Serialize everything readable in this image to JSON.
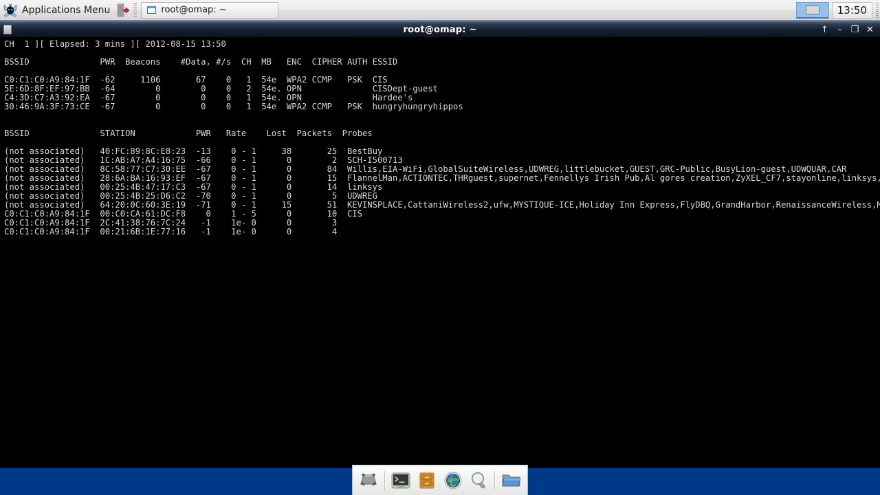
{
  "panel": {
    "applications_menu_label": "Applications Menu",
    "mouse_icon": "xfce-mouse-icon",
    "logout_icon": "logout-door-icon",
    "window_button": {
      "label": "root@omap: ~",
      "icon": "window-icon"
    },
    "pager_icon": "workspace-pager-icon",
    "clock": "13:50"
  },
  "window": {
    "title": "root@omap: ~",
    "buttons": [
      {
        "name": "shade-button",
        "glyph": "↑"
      },
      {
        "name": "minimize-button",
        "glyph": "–"
      },
      {
        "name": "maximize-button",
        "glyph": "❐"
      },
      {
        "name": "close-button",
        "glyph": "✕"
      }
    ]
  },
  "terminal": {
    "status_line": "CH  1 ][ Elapsed: 3 mins ][ 2012-08-15 13:50",
    "ap_header": "BSSID              PWR  Beacons    #Data, #/s  CH  MB   ENC  CIPHER AUTH ESSID",
    "ap_rows": [
      "C0:C1:C0:A9:84:1F  -62     1106       67    0   1  54e  WPA2 CCMP   PSK  CIS",
      "5E:6D:8F:EF:97:BB  -64        0        0    0   2  54e. OPN              CISDept-guest",
      "C4:3D:C7:A3:92:EA  -67        0        0    0   1  54e. OPN              Hardee's",
      "30:46:9A:3F:73:CE  -67        0        0    0   1  54e  WPA2 CCMP   PSK  hungryhungryhippos"
    ],
    "sta_header": "BSSID              STATION            PWR   Rate    Lost  Packets  Probes",
    "sta_rows": [
      "(not associated)   40:FC:89:8C:E8:23  -13    0 - 1     38       25  BestBuy",
      "(not associated)   1C:AB:A7:A4:16:75  -66    0 - 1      0        2  SCH-I500713",
      "(not associated)   8C:58:77:C7:30:EE  -67    0 - 1      0       84  Willis,EIA-WiFi,GlobalSuiteWireless,UDWREG,littlebucket,GUEST,GRC-Public,BusyLion-guest,UDWQUAR,CAR",
      "(not associated)   28:6A:BA:16:93:EF  -67    0 - 1      0       15  FlannelMan,ACTIONTEC,THRguest,supernet,Fennellys Irish Pub,Al gores creation,ZyXEL_CF7,stayonline,linksys,Central wireless",
      "(not associated)   00:25:4B:47:17:C3  -67    0 - 1      0       14  linksys",
      "(not associated)   00:25:4B:25:D6:C2  -70    0 - 1      0        5  UDWREG",
      "(not associated)   64:20:0C:60:3E:19  -71    0 - 1     15       51  KEVINSPLACE,CattaniWireless2,ufw,MYSTIQUE-ICE,Holiday Inn Express,FlyDBQ,GrandHarbor,RenaissanceWireless,Miller's Ale House,linksys",
      "C0:C1:C0:A9:84:1F  00:C0:CA:61:DC:F8    0    1 - 5      0       10  CIS",
      "C0:C1:C0:A9:84:1F  2C:41:38:76:7C:24   -1    1e- 0      0        3",
      "C0:C1:C0:A9:84:1F  00:21:6B:1E:77:16   -1    1e- 0      0        4"
    ]
  },
  "dock": {
    "items": [
      {
        "name": "show-desktop-icon",
        "title": "Show Desktop"
      },
      {
        "name": "terminal-icon",
        "title": "Terminal Emulator"
      },
      {
        "name": "file-archive-icon",
        "title": "Archive Manager"
      },
      {
        "name": "web-browser-icon",
        "title": "Web Browser"
      },
      {
        "name": "search-icon",
        "title": "Find Files"
      },
      {
        "name": "file-manager-icon",
        "title": "File Manager"
      }
    ]
  },
  "colors": {
    "desktop": "#003C8F",
    "terminal_bg": "#000000",
    "terminal_fg": "#d8d8d8",
    "panel_bg": "#ececea",
    "titlebar_bg": "#14202f"
  }
}
